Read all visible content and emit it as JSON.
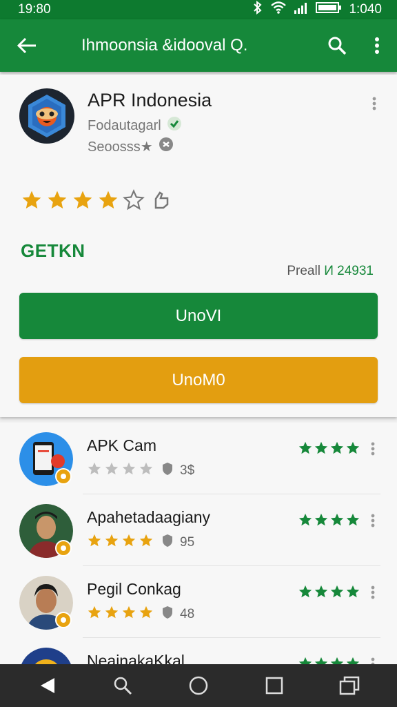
{
  "status": {
    "time": "19:80",
    "clock": "1:040"
  },
  "appbar": {
    "title": "Ihmoonsia &idooval Q."
  },
  "app": {
    "name": "APR Indonesia",
    "developer": "Fodautagarl",
    "category": "Seoosss★",
    "rating_stars": 4,
    "rating_max": 5,
    "get_label": "GETKN",
    "price_label": "Preall",
    "price_value": "И 24931",
    "install_button": "UnoVI",
    "secondary_button": "UnoM0",
    "colors": {
      "primary": "#16883a",
      "accent": "#e39e10"
    }
  },
  "list": [
    {
      "name": "APK Cam",
      "rating_stars": 0,
      "count": "3$",
      "right_stars": 4
    },
    {
      "name": "Apahetadaagiany",
      "rating_stars": 4,
      "count": "95",
      "right_stars": 4
    },
    {
      "name": "Pegil Conkag",
      "rating_stars": 4,
      "count": "48",
      "right_stars": 4
    },
    {
      "name": "NeainakaKkal",
      "rating_stars": 0,
      "count": "",
      "right_stars": 4
    }
  ],
  "icons": [
    "back-arrow-icon",
    "search-icon",
    "more-vert-icon",
    "bluetooth-icon",
    "wifi-icon",
    "signal-icon",
    "battery-icon",
    "nav-back-icon",
    "nav-search-icon",
    "nav-home-icon",
    "nav-recents-icon",
    "nav-overview-icon"
  ]
}
